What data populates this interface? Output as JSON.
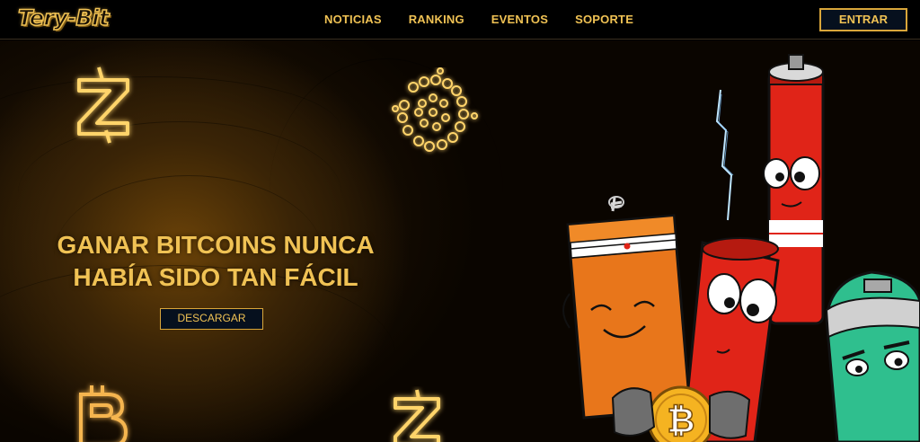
{
  "header": {
    "logo_text": "Tery-Bit",
    "nav": [
      {
        "label": "NOTICIAS"
      },
      {
        "label": "RANKING"
      },
      {
        "label": "EVENTOS"
      },
      {
        "label": "SOPORTE"
      }
    ],
    "login_label": "ENTRAR"
  },
  "hero": {
    "headline_line1": "GANAR BITCOINS NUNCA",
    "headline_line2": "HABÍA SIDO TAN FÁCIL",
    "download_label": "DESCARGAR",
    "coin_symbol": "₿",
    "decorative_icons": [
      "zcash-icon",
      "iota-icon",
      "bitcoin-icon",
      "zcash-icon"
    ]
  },
  "colors": {
    "accent": "#f0c254",
    "button_bg": "#06101e",
    "button_border": "#d9a63a",
    "background": "#000000"
  }
}
